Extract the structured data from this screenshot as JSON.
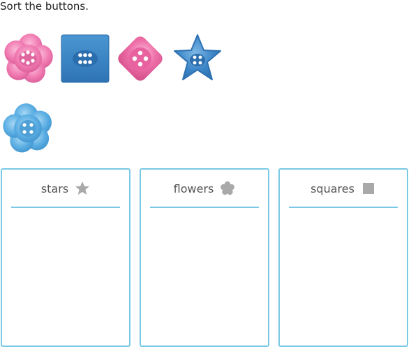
{
  "instruction": "Sort the buttons.",
  "buttons": [
    {
      "shape": "flower",
      "color": "#f07ab1"
    },
    {
      "shape": "square",
      "color": "#3a86c6"
    },
    {
      "shape": "diamond",
      "color": "#ee6fa9"
    },
    {
      "shape": "star",
      "color": "#3c86c8"
    },
    {
      "shape": "flower",
      "color": "#5aaee3"
    }
  ],
  "bins": [
    {
      "label": "stars",
      "icon": "star-icon"
    },
    {
      "label": "flowers",
      "icon": "flower-icon"
    },
    {
      "label": "squares",
      "icon": "square-icon"
    }
  ],
  "colors": {
    "bin_border": "#79c9e6",
    "icon_gray": "#a9a9a9"
  }
}
